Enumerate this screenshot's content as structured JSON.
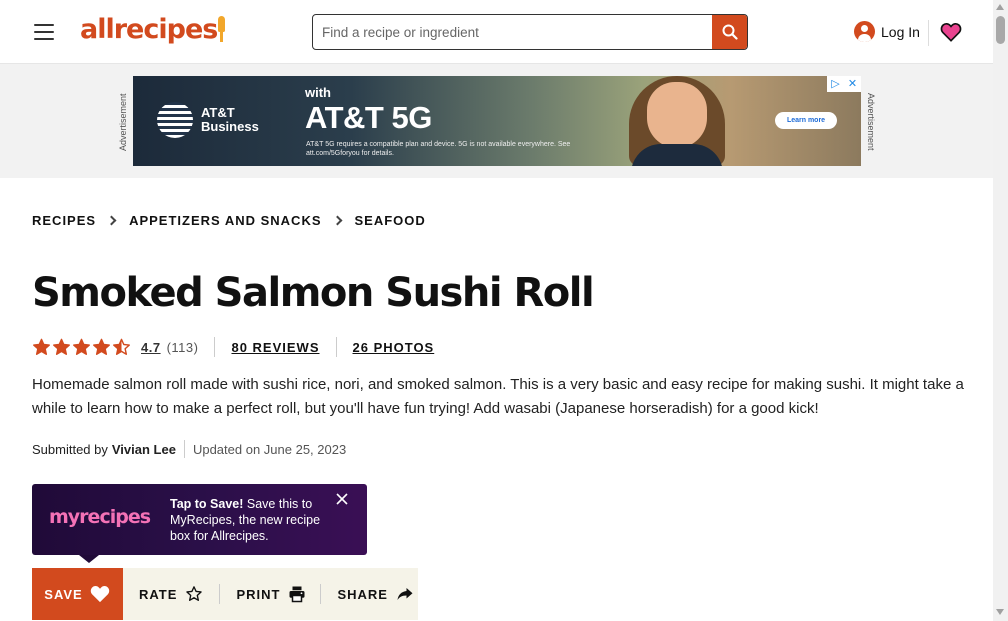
{
  "header": {
    "logo_text": "allrecipes",
    "search_placeholder": "Find a recipe or ingredient",
    "login_label": "Log In"
  },
  "ad": {
    "side_label": "Advertisement",
    "brand_line1": "AT&T",
    "brand_line2": "Business",
    "with_text": "with",
    "headline": "AT&T 5G",
    "fine_print": "AT&T 5G requires a compatible plan and device. 5G is not available everywhere. See att.com/5Gforyou for details.",
    "cta_label": "Learn more"
  },
  "breadcrumb": {
    "items": [
      "RECIPES",
      "APPETIZERS AND SNACKS",
      "SEAFOOD"
    ]
  },
  "recipe": {
    "title": "Smoked Salmon Sushi Roll",
    "rating": "4.7",
    "rating_count": "(113)",
    "rating_fraction": 0.94,
    "reviews_link": "80 REVIEWS",
    "photos_link": "26 PHOTOS",
    "description": "Homemade salmon roll made with sushi rice, nori, and smoked salmon. This is a very basic and easy recipe for making sushi. It might take a while to learn how to make a perfect roll, but you'll have fun trying! Add wasabi (Japanese horseradish) for a good kick!",
    "submitted_by_label": "Submitted by",
    "author": "Vivian Lee",
    "updated": "Updated on June 25, 2023"
  },
  "popup": {
    "logo_text": "myrecipes",
    "bold_text": "Tap to Save!",
    "body_text": " Save this to MyRecipes, the new recipe box for Allrecipes."
  },
  "actions": {
    "save_label": "SAVE",
    "rate_label": "RATE",
    "print_label": "PRINT",
    "share_label": "SHARE"
  },
  "colors": {
    "brand": "#d24a1e",
    "star": "#d24a1e",
    "popup_bg": "#200a38",
    "popup_logo": "#f472b6",
    "action_bar": "#f5f3e8"
  }
}
